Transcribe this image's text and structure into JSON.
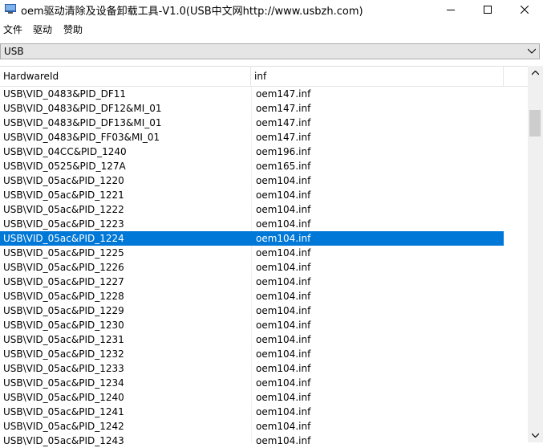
{
  "window": {
    "title": "oem驱动清除及设备卸载工具-V1.0(USB中文网http://www.usbzh.com)",
    "minimize_icon": "minimize-icon",
    "maximize_icon": "maximize-icon",
    "close_icon": "close-icon"
  },
  "menu": {
    "file": "文件",
    "driver": "驱动",
    "donate": "赞助"
  },
  "filter": {
    "selected": "USB"
  },
  "table": {
    "columns": [
      "HardwareId",
      "inf"
    ],
    "rows": [
      [
        "USB\\VID_0483&PID_DF11",
        "oem147.inf"
      ],
      [
        "USB\\VID_0483&PID_DF12&MI_01",
        "oem147.inf"
      ],
      [
        "USB\\VID_0483&PID_DF13&MI_01",
        "oem147.inf"
      ],
      [
        "USB\\VID_0483&PID_FF03&MI_01",
        "oem147.inf"
      ],
      [
        "USB\\VID_04CC&PID_1240",
        "oem196.inf"
      ],
      [
        "USB\\VID_0525&PID_127A",
        "oem165.inf"
      ],
      [
        "USB\\VID_05ac&PID_1220",
        "oem104.inf"
      ],
      [
        "USB\\VID_05ac&PID_1221",
        "oem104.inf"
      ],
      [
        "USB\\VID_05ac&PID_1222",
        "oem104.inf"
      ],
      [
        "USB\\VID_05ac&PID_1223",
        "oem104.inf"
      ],
      [
        "USB\\VID_05ac&PID_1224",
        "oem104.inf"
      ],
      [
        "USB\\VID_05ac&PID_1225",
        "oem104.inf"
      ],
      [
        "USB\\VID_05ac&PID_1226",
        "oem104.inf"
      ],
      [
        "USB\\VID_05ac&PID_1227",
        "oem104.inf"
      ],
      [
        "USB\\VID_05ac&PID_1228",
        "oem104.inf"
      ],
      [
        "USB\\VID_05ac&PID_1229",
        "oem104.inf"
      ],
      [
        "USB\\VID_05ac&PID_1230",
        "oem104.inf"
      ],
      [
        "USB\\VID_05ac&PID_1231",
        "oem104.inf"
      ],
      [
        "USB\\VID_05ac&PID_1232",
        "oem104.inf"
      ],
      [
        "USB\\VID_05ac&PID_1233",
        "oem104.inf"
      ],
      [
        "USB\\VID_05ac&PID_1234",
        "oem104.inf"
      ],
      [
        "USB\\VID_05ac&PID_1240",
        "oem104.inf"
      ],
      [
        "USB\\VID_05ac&PID_1241",
        "oem104.inf"
      ],
      [
        "USB\\VID_05ac&PID_1242",
        "oem104.inf"
      ],
      [
        "USB\\VID_05ac&PID_1243",
        "oem104.inf"
      ]
    ],
    "selected_index": 10
  },
  "colors": {
    "selection": "#0078d7"
  }
}
